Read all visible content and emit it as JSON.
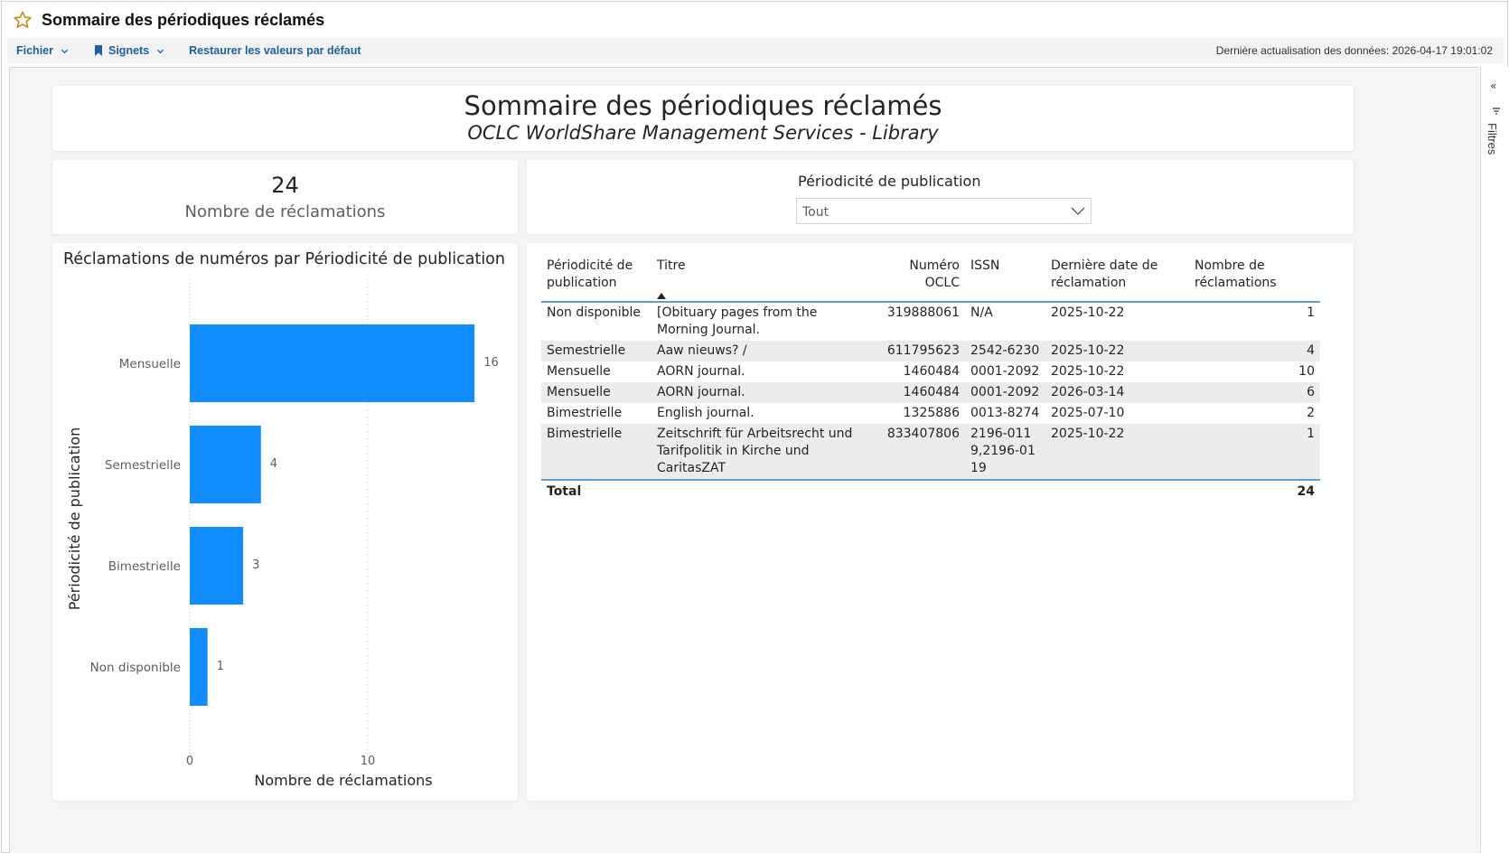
{
  "app": {
    "title": "Sommaire des périodiques réclamés"
  },
  "toolbar": {
    "file_label": "Fichier",
    "bookmarks_label": "Signets",
    "reset_label": "Restaurer les valeurs par défaut",
    "refresh_text": "Dernière actualisation des données: 2026-04-17 19:01:02"
  },
  "filters_pane": {
    "label": "Filtres"
  },
  "report": {
    "title": "Sommaire des périodiques réclamés",
    "subtitle": "OCLC WorldShare Management Services - Library"
  },
  "kpi": {
    "value": "24",
    "label": "Nombre de réclamations"
  },
  "slicer": {
    "title": "Périodicité de publication",
    "selected": "Tout"
  },
  "chart_data": {
    "type": "bar",
    "orientation": "horizontal",
    "title": "Réclamations de numéros par Périodicité de publication",
    "xlabel": "Nombre de réclamations",
    "ylabel": "Périodicité de publication",
    "categories": [
      "Mensuelle",
      "Semestrielle",
      "Bimestrielle",
      "Non disponible"
    ],
    "values": [
      16,
      4,
      3,
      1
    ],
    "data_labels": [
      "16",
      "4",
      "3",
      "1"
    ],
    "xticks": [
      "0",
      "10"
    ],
    "xlim": [
      0,
      17
    ],
    "grid": true,
    "bar_color": "#118DFF"
  },
  "table": {
    "headers": [
      "Périodicité de publication",
      "Titre",
      "Numéro OCLC",
      "ISSN",
      "Dernière date de réclamation",
      "Nombre de réclamations"
    ],
    "header_lines": [
      [
        "Périodicité de",
        "publication"
      ],
      [
        "Titre"
      ],
      [
        "Numéro OCLC"
      ],
      [
        "ISSN"
      ],
      [
        "Dernière date de",
        "réclamation"
      ],
      [
        "Nombre de",
        "réclamations"
      ]
    ],
    "rows": [
      [
        "Non disponible",
        "[Obituary pages from the Morning Journal.",
        "319888061",
        "N/A",
        "2025-10-22",
        "1"
      ],
      [
        "Semestrielle",
        "Aaw nieuws? /",
        "611795623",
        "2542-6230",
        "2025-10-22",
        "4"
      ],
      [
        "Mensuelle",
        "AORN journal.",
        "1460484",
        "0001-2092",
        "2025-10-22",
        "10"
      ],
      [
        "Mensuelle",
        "AORN journal.",
        "1460484",
        "0001-2092",
        "2026-03-14",
        "6"
      ],
      [
        "Bimestrielle",
        "English journal.",
        "1325886",
        "0013-8274",
        "2025-07-10",
        "2"
      ],
      [
        "Bimestrielle",
        "Zeitschrift für Arbeitsrecht und Tarifpolitik in Kirche und CaritasZAT",
        "833407806",
        "2196-0119,2196-0119",
        "2025-10-22",
        "1"
      ]
    ],
    "total_label": "Total",
    "total_value": "24"
  },
  "colors": {
    "accent": "#118DFF",
    "link": "#1D5FA6",
    "table_rule": "#5AA0D8",
    "star": "#C98A1B"
  }
}
